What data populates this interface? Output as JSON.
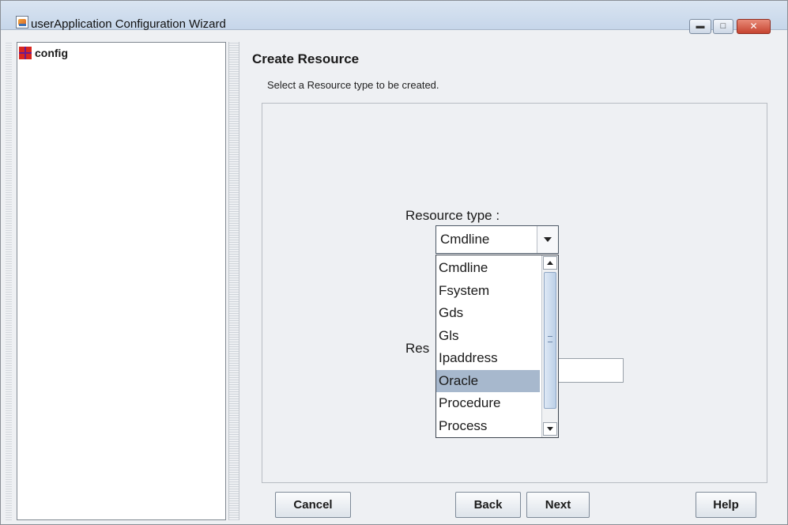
{
  "window": {
    "title": "userApplication Configuration Wizard",
    "controls": [
      "minimize-icon",
      "maximize-icon",
      "close-icon"
    ]
  },
  "tree": {
    "items": [
      {
        "label": "config",
        "icon": "config-node-icon"
      }
    ]
  },
  "main": {
    "heading": "Create Resource",
    "subheading": "Select a Resource type to be created.",
    "resource_type_label": "Resource type  :",
    "resource_name_label_visible": "Res",
    "resource_type_combo": {
      "selected": "Cmdline",
      "options": [
        "Cmdline",
        "Fsystem",
        "Gds",
        "Gls",
        "Ipaddress",
        "Oracle",
        "Procedure",
        "Process"
      ],
      "highlighted": "Oracle"
    },
    "resource_name_value": ""
  },
  "buttons": {
    "cancel": "Cancel",
    "back": "Back",
    "next": "Next",
    "help": "Help"
  },
  "colors": {
    "titlebar": "#c6d6ea",
    "selection": "#a7b8cd",
    "close_button": "#c64430",
    "tree_icon": "#d8261f"
  }
}
